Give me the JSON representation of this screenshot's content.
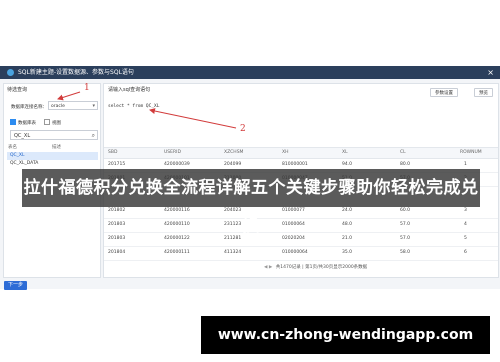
{
  "window": {
    "title": "SQL新建主题-设置数据源、参数与SQL语句",
    "close_glyph": "×"
  },
  "left_panel": {
    "label": "待选查询",
    "db_label": "数据库连接名称：",
    "db_value": "oracle",
    "checkbox_tables": "数据库表",
    "checkbox_views": "视图",
    "search_value": "QC_XL",
    "search_icon": "search-icon",
    "columns": [
      "表名",
      "描述"
    ],
    "items": [
      "QC_XL",
      "QC_XL_DATA"
    ]
  },
  "right_panel": {
    "tab_label": "请输入sql查询语句",
    "buttons": [
      "参数设置",
      "预览"
    ],
    "sql_text": "select * from QC_XL",
    "columns": [
      "SBD",
      "USERID",
      "XZCHSM",
      "XH",
      "XL",
      "CL",
      "ROWNUM"
    ],
    "rows": [
      [
        "201715",
        "420000039",
        "204099",
        "810000001",
        "94.0",
        "80.0",
        "1"
      ],
      [
        "201801",
        "420000101",
        "211000",
        "010000047",
        "51.0",
        "57.0",
        "2"
      ],
      [
        "201802",
        "420000116",
        "204023",
        "01000077",
        "24.0",
        "60.0",
        "3"
      ],
      [
        "201803",
        "420000110",
        "231123",
        "01000064",
        "48.0",
        "57.0",
        "4"
      ],
      [
        "201803",
        "420000122",
        "211281",
        "02020204",
        "21.0",
        "57.0",
        "5"
      ],
      [
        "201804",
        "420000111",
        "411324",
        "010000064",
        "35.0",
        "58.0",
        "6"
      ]
    ],
    "pager": "共1470记录 | 第1页/共30页显示2000条数据"
  },
  "next_button": "下一步",
  "annotations": [
    "1",
    "2"
  ],
  "banner": "拉什福德积分兑换全流程详解五个关键步骤助你轻松完成兑换",
  "footer": "www.cn-zhong-wendingapp.com",
  "colors": {
    "titlebar": "#2b3f5c",
    "accent": "#2d6cd6",
    "arrow": "#d23b3b"
  }
}
